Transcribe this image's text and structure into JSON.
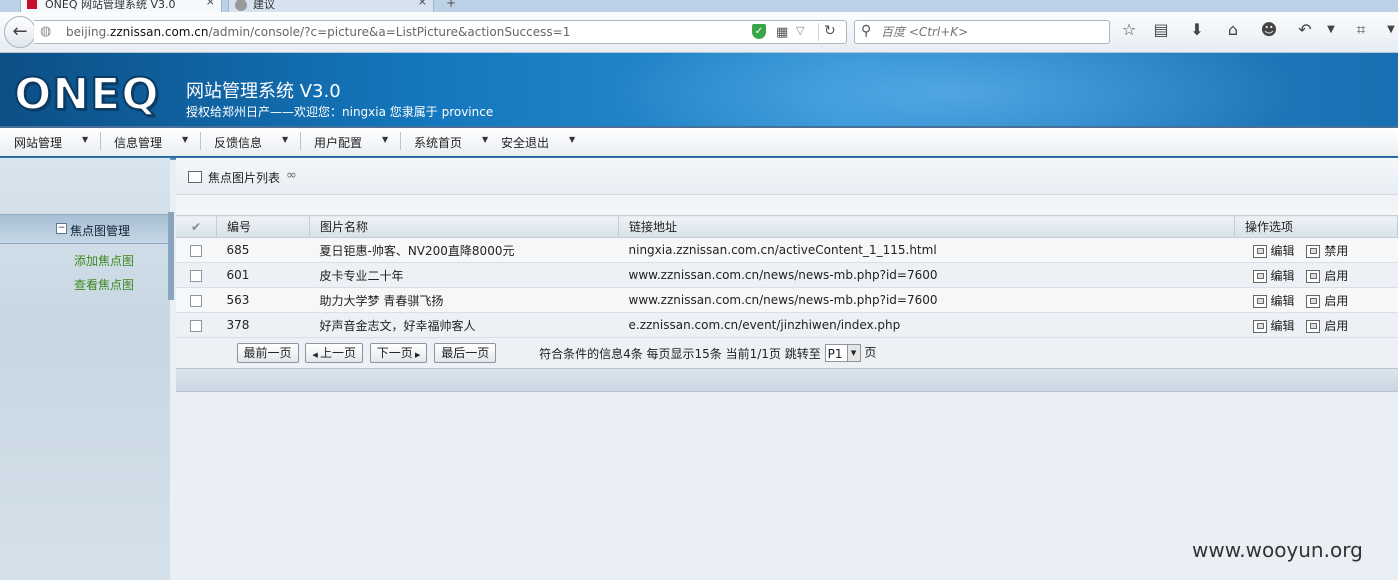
{
  "browser": {
    "tabs": [
      {
        "title": "ONEQ 网站管理系统 V3.0",
        "close": "×"
      },
      {
        "title": "建议",
        "close": "×"
      }
    ],
    "new_tab": "+",
    "url_prefix": "beijing.",
    "url_domain": "zznissan.com.cn",
    "url_path": "/admin/console/?c=picture&a=ListPicture&actionSuccess=1",
    "search_placeholder": "百度 <Ctrl+K>",
    "toolbar_icons": [
      "star-icon",
      "reading-list-icon",
      "download-icon",
      "home-icon",
      "chat-icon",
      "undo-icon",
      "dropdown-icon",
      "crop-icon",
      "overflow-icon"
    ]
  },
  "app": {
    "logo": "ONEQ",
    "title": "网站管理系统 V3.0",
    "subtitle": "授权给郑州日产——欢迎您：ningxia 您隶属于 province",
    "brand_color": "#1477bd"
  },
  "menu": [
    {
      "label": "网站管理"
    },
    {
      "label": "信息管理"
    },
    {
      "label": "反馈信息"
    },
    {
      "label": "用户配置"
    },
    {
      "label": "系统首页"
    },
    {
      "label": "安全退出"
    }
  ],
  "sidebar": {
    "section": "焦点图管理",
    "collapse": "−",
    "links": [
      {
        "label": "添加焦点图"
      },
      {
        "label": "查看焦点图"
      }
    ]
  },
  "panel": {
    "title": "焦点图片列表",
    "columns": {
      "id": "编号",
      "name": "图片名称",
      "url": "链接地址",
      "ops": "操作选项"
    },
    "rows": [
      {
        "id": "685",
        "name": "夏日钜惠-帅客、NV200直降8000元",
        "url": "ningxia.zznissan.com.cn/activeContent_1_115.html",
        "edit": "编辑",
        "toggle": "禁用"
      },
      {
        "id": "601",
        "name": "皮卡专业二十年",
        "url": "www.zznissan.com.cn/news/news-mb.php?id=7600",
        "edit": "编辑",
        "toggle": "启用"
      },
      {
        "id": "563",
        "name": "助力大学梦 青春骐飞扬",
        "url": "www.zznissan.com.cn/news/news-mb.php?id=7600",
        "edit": "编辑",
        "toggle": "启用"
      },
      {
        "id": "378",
        "name": "好声音金志文，好幸福帅客人",
        "url": "e.zznissan.com.cn/event/jinzhiwen/index.php",
        "edit": "编辑",
        "toggle": "启用"
      }
    ],
    "pager": {
      "first": "最前一页",
      "prev": "上一页",
      "next": "下一页",
      "last": "最后一页",
      "info": "符合条件的信息4条 每页显示15条 当前1/1页 跳转至",
      "page_value": "P1",
      "suffix": "页"
    }
  },
  "watermark": "www.wooyun.org"
}
